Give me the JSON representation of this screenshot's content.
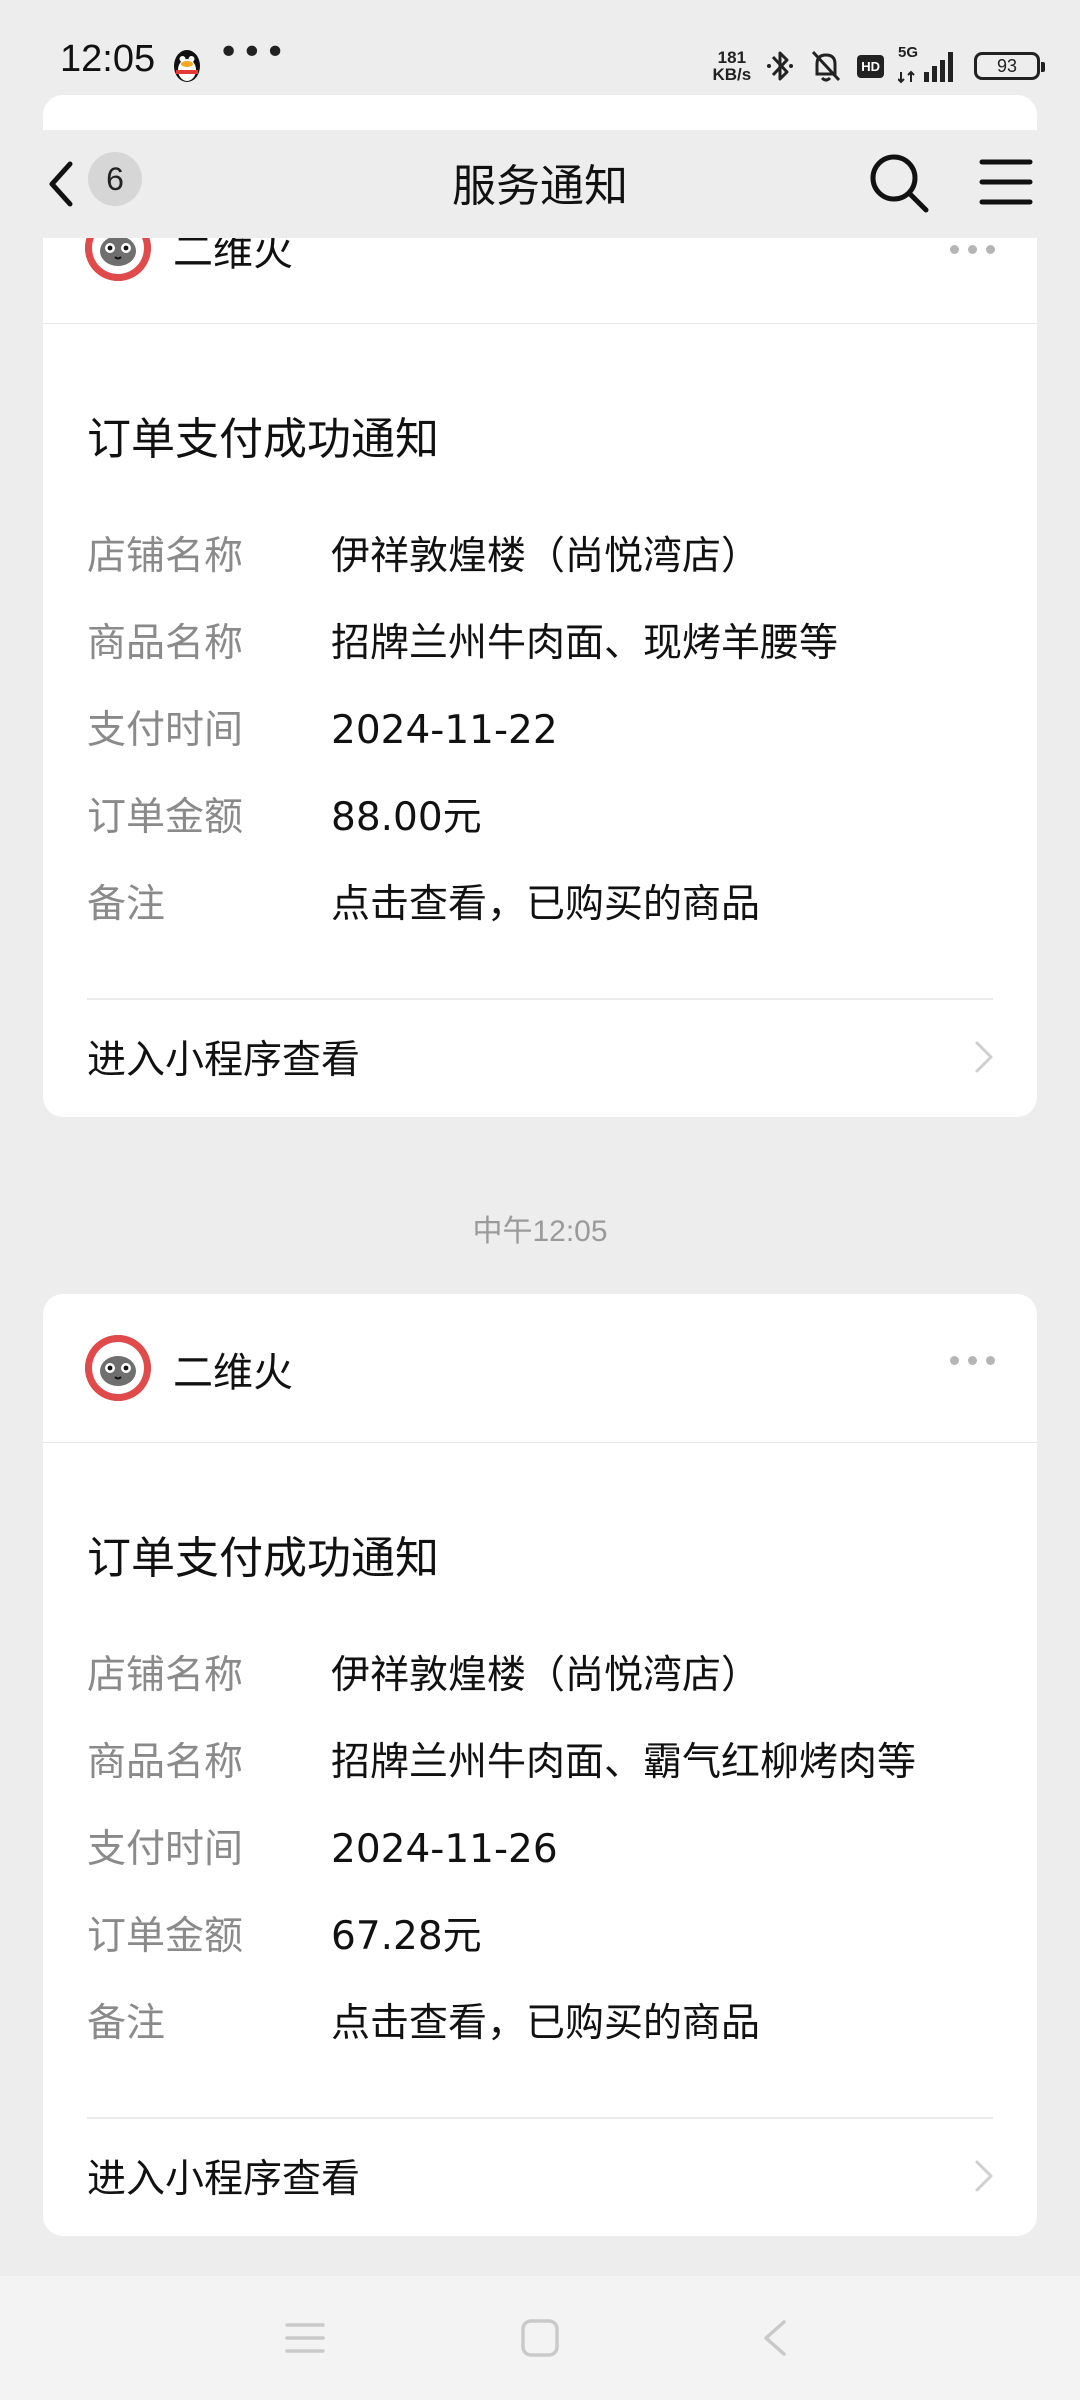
{
  "status_bar": {
    "time": "12:05",
    "net_speed_value": "181",
    "net_speed_unit": "KB/s",
    "signal_label": "5G",
    "hd_label": "HD",
    "battery": "93"
  },
  "nav": {
    "unread_count": "6",
    "title": "服务通知"
  },
  "cards": [
    {
      "sender": "二维火",
      "title": "订单支付成功通知",
      "fields": [
        {
          "label": "店铺名称",
          "value": "伊祥敦煌楼（尚悦湾店）"
        },
        {
          "label": "商品名称",
          "value": "招牌兰州牛肉面、现烤羊腰等"
        },
        {
          "label": "支付时间",
          "value": "2024-11-22"
        },
        {
          "label": "订单金额",
          "value": "88.00元"
        },
        {
          "label": "备注",
          "value": "点击查看，已购买的商品"
        }
      ],
      "link_label": "进入小程序查看"
    },
    {
      "sender": "二维火",
      "title": "订单支付成功通知",
      "fields": [
        {
          "label": "店铺名称",
          "value": "伊祥敦煌楼（尚悦湾店）"
        },
        {
          "label": "商品名称",
          "value": "招牌兰州牛肉面、霸气红柳烤肉等"
        },
        {
          "label": "支付时间",
          "value": "2024-11-26"
        },
        {
          "label": "订单金额",
          "value": "67.28元"
        },
        {
          "label": "备注",
          "value": "点击查看，已购买的商品"
        }
      ],
      "link_label": "进入小程序查看"
    }
  ],
  "timestamp_between": "中午12:05",
  "colors": {
    "background": "#ededed",
    "card": "#ffffff",
    "label_gray": "#8a8a8a",
    "avatar_red": "#e04a4a"
  },
  "icons": [
    "qq-penguin-icon",
    "more-icon",
    "bluetooth-icon",
    "mute-bell-icon",
    "signal-icon",
    "back-icon",
    "search-icon",
    "menu-icon",
    "chevron-right-icon",
    "nav-recents-icon",
    "nav-home-icon",
    "nav-back-icon"
  ]
}
